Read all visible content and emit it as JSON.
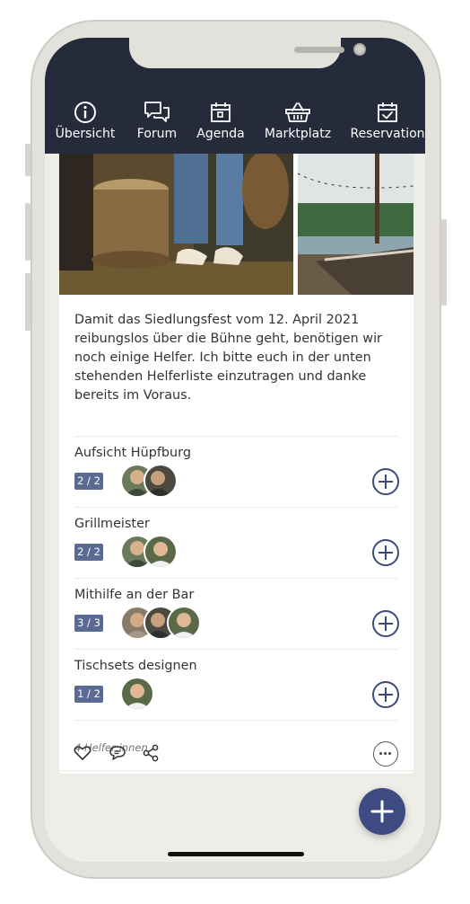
{
  "nav": {
    "items": [
      {
        "label": "Übersicht",
        "icon": "info-icon"
      },
      {
        "label": "Forum",
        "icon": "chat-icon"
      },
      {
        "label": "Agenda",
        "icon": "calendar-icon"
      },
      {
        "label": "Marktplatz",
        "icon": "basket-icon"
      },
      {
        "label": "Reservation",
        "icon": "calendar-check-icon"
      }
    ],
    "active": "Forum"
  },
  "post": {
    "description": "Damit das Siedlungsfest vom 12. April 2021 reibungslos über die Bühne geht, benötigen wir noch einige Helfer. Ich bitte euch in der unten stehenden Helferliste einzutragen und danke bereits im Voraus.",
    "tasks": [
      {
        "title": "Aufsicht Hüpfburg",
        "count": "2 / 2"
      },
      {
        "title": "Grillmeister",
        "count": "2 / 2"
      },
      {
        "title": "Mithilfe an der Bar",
        "count": "3 / 3"
      },
      {
        "title": "Tischsets designen",
        "count": "1 / 2"
      }
    ],
    "helpers_summary": "4 Helfer:innen"
  },
  "colors": {
    "header": "#252b3b",
    "accent": "#3d4b82",
    "badge": "#5b6a94"
  }
}
